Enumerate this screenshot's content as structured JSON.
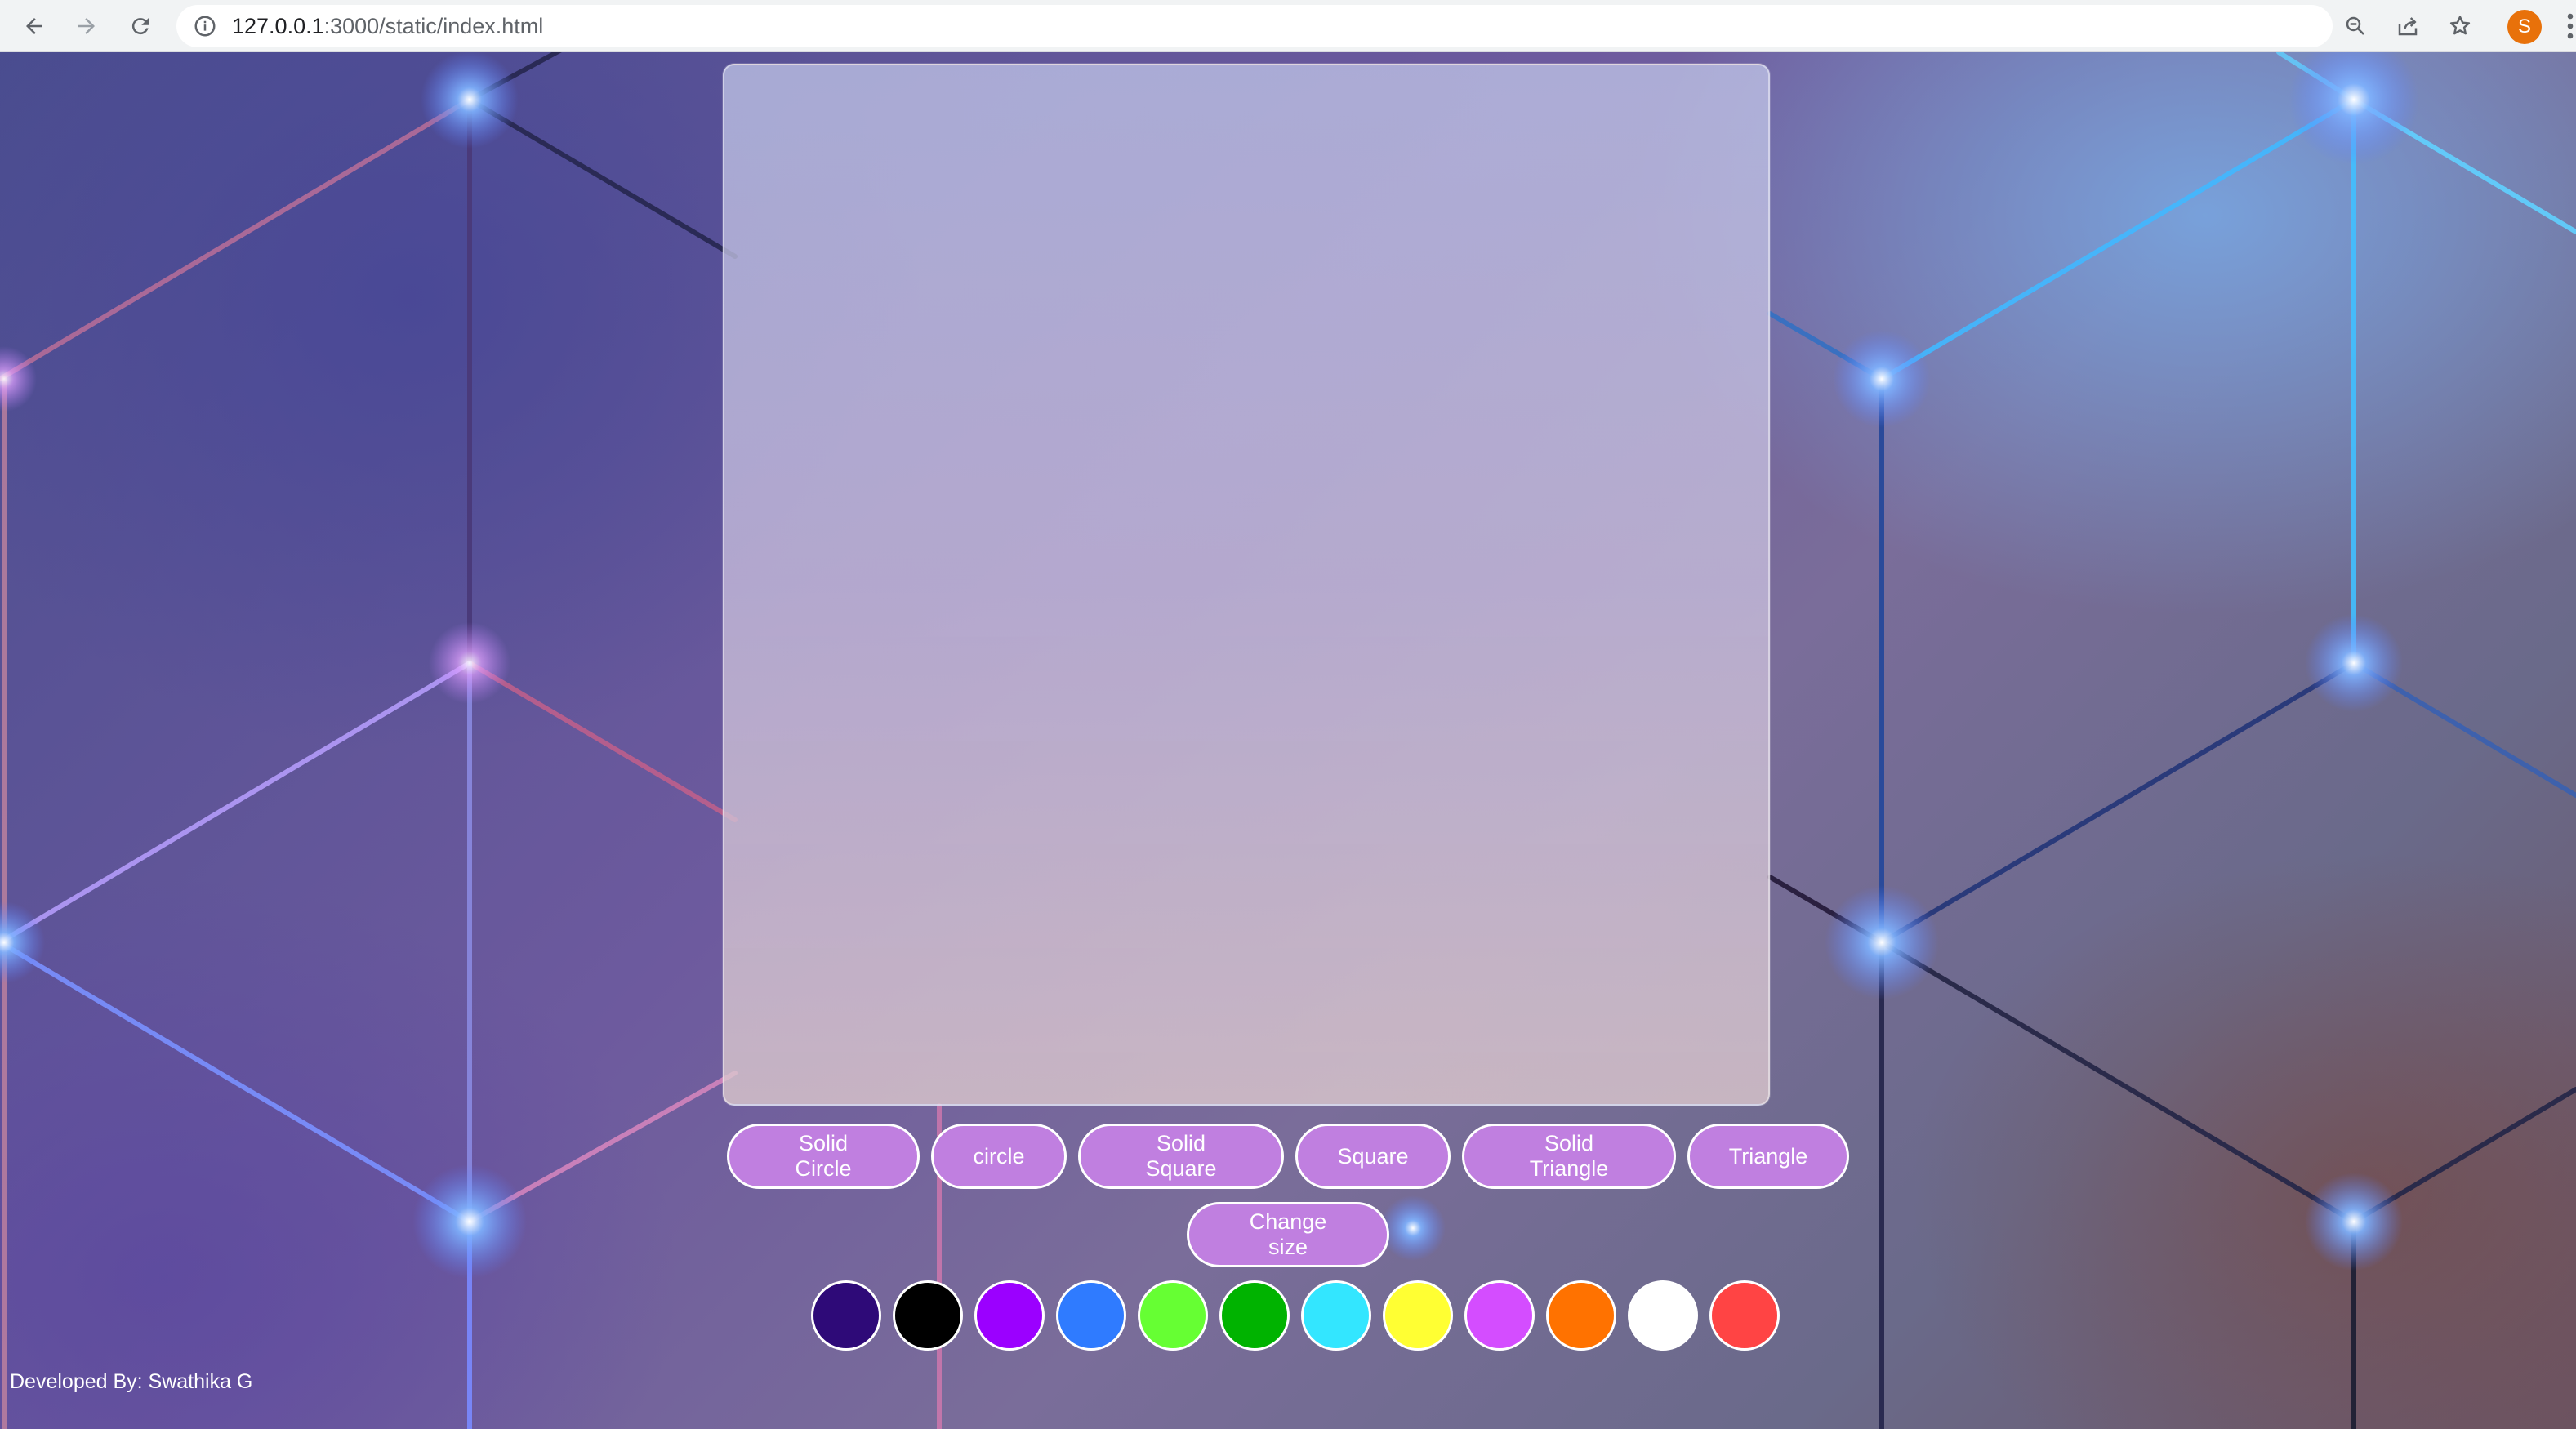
{
  "browser": {
    "url_host": "127.0.0.1",
    "url_rest": ":3000/static/index.html",
    "avatar_letter": "S",
    "icons": [
      "back-icon",
      "forward-icon",
      "reload-icon",
      "info-icon",
      "zoom-icon",
      "share-icon",
      "star-icon",
      "menu-icon"
    ]
  },
  "shapes": {
    "buttons": [
      "Solid Circle",
      "circle",
      "Solid Square",
      "Square",
      "Solid Triangle",
      "Triangle"
    ],
    "change_size_label": "Change size"
  },
  "colors": {
    "swatches": [
      "#2e0a78",
      "#000000",
      "#9b00ff",
      "#2f7bff",
      "#66ff33",
      "#00b300",
      "#33e6ff",
      "#ffff33",
      "#d44dff",
      "#ff7200",
      "#ffffff",
      "#ff4444"
    ]
  },
  "footer": {
    "credit": "Developed By: Swathika G"
  }
}
